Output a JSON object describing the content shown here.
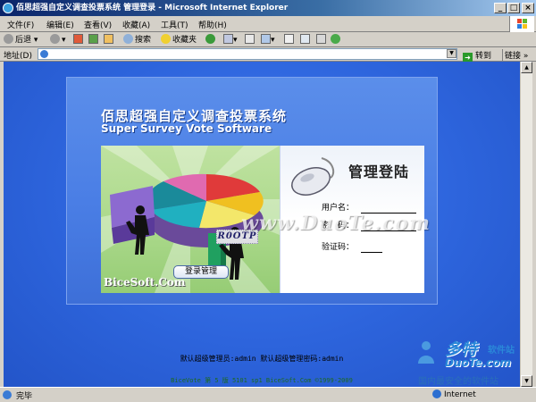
{
  "window": {
    "title": "佰思超强自定义调查投票系统 管理登录 - Microsoft Internet Explorer",
    "minimize": "_",
    "maximize": "□",
    "close": "×"
  },
  "menu": {
    "items": [
      "文件(F)",
      "编辑(E)",
      "查看(V)",
      "收藏(A)",
      "工具(T)",
      "帮助(H)"
    ]
  },
  "toolbar": {
    "back": "后退",
    "search": "搜索",
    "favorites": "收藏夹"
  },
  "address": {
    "label": "地址(D)",
    "value": "",
    "go": "转到",
    "links": "链接"
  },
  "page": {
    "title_cn": "佰思超强自定义调查投票系统",
    "title_en": "Super Survey Vote Software",
    "brand": "BiceSoft.Com",
    "login_heading": "管理登陆",
    "username_label": "用户名：",
    "password_label": "密　码：",
    "captcha_label": "验证码：",
    "captcha_value": "R0OTP",
    "login_button": "登录管理",
    "watermark": "www.DuoTe.com",
    "default_credentials": "默认超级管理员:admin 默认超级管理密码:admin",
    "copyright": "BiceVote 第 5 版 5101 sp1 BiceSoft.Com ©1999-2009"
  },
  "site_logo": {
    "name_cn": "多特",
    "sub": "软件站",
    "name_en": "DuoTe.com",
    "slogan": "国内最安全的软件站"
  },
  "status": {
    "text": "完毕",
    "zone": "Internet"
  },
  "colors": {
    "page_background": "#2d64dc",
    "panel": "#4a7ee5",
    "title_bar": "#0a246a"
  }
}
